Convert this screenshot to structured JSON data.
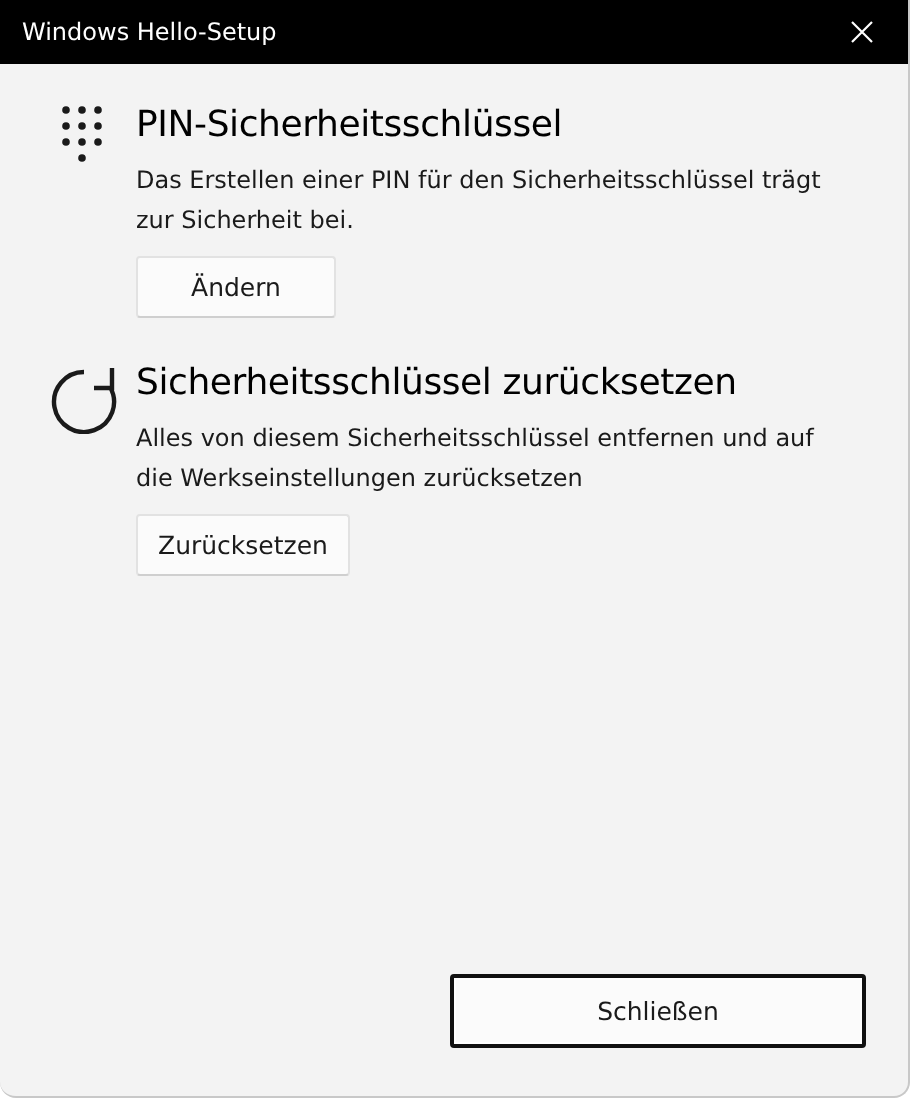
{
  "window": {
    "title": "Windows Hello-Setup"
  },
  "sections": [
    {
      "kind": "pin",
      "heading": "PIN-Sicherheitsschlüssel",
      "description": "Das Erstellen einer PIN für den Sicherheitsschlüssel trägt zur Sicherheit bei.",
      "button": "Ändern"
    },
    {
      "kind": "reset",
      "heading": "Sicherheitsschlüssel zurücksetzen",
      "description": "Alles von diesem Sicherheitsschlüssel entfernen und auf die Werkseinstellungen zurücksetzen",
      "button": "Zurücksetzen"
    }
  ],
  "footer": {
    "button": "Schließen",
    "focused": true
  }
}
